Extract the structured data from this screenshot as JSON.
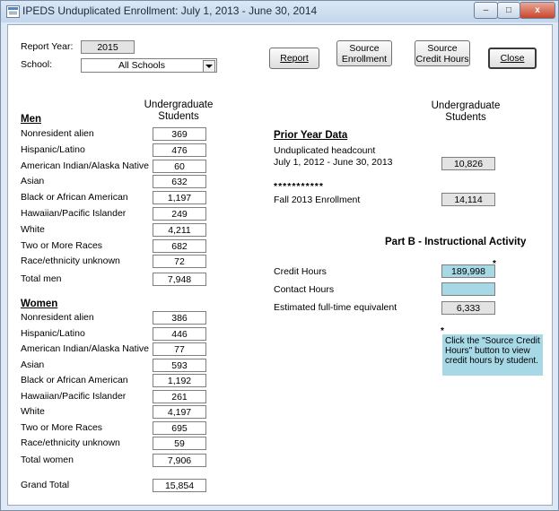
{
  "window": {
    "title": "IPEDS Unduplicated Enrollment:  July 1, 2013 - June 30, 2014",
    "minimize": "–",
    "maximize": "□",
    "close": "x"
  },
  "header": {
    "report_year_label": "Report Year:",
    "report_year_value": "2015",
    "school_label": "School:",
    "school_value": "All Schools"
  },
  "buttons": {
    "report": "Report",
    "source_enrollment": "Source\nEnrollment",
    "source_credit_hours": "Source\nCredit Hours",
    "close": "Close"
  },
  "left_column_header": "Undergraduate\nStudents",
  "men": {
    "title": "Men",
    "rows": [
      {
        "label": "Nonresident alien",
        "value": "369"
      },
      {
        "label": "Hispanic/Latino",
        "value": "476"
      },
      {
        "label": "American Indian/Alaska Native",
        "value": "60"
      },
      {
        "label": "Asian",
        "value": "632"
      },
      {
        "label": "Black or African American",
        "value": "1,197"
      },
      {
        "label": "Hawaiian/Pacific Islander",
        "value": "249"
      },
      {
        "label": "White",
        "value": "4,211"
      },
      {
        "label": "Two or More Races",
        "value": "682"
      },
      {
        "label": "Race/ethnicity unknown",
        "value": "72"
      }
    ],
    "total_label": "Total men",
    "total_value": "7,948"
  },
  "women": {
    "title": "Women",
    "rows": [
      {
        "label": "Nonresident alien",
        "value": "386"
      },
      {
        "label": "Hispanic/Latino",
        "value": "446"
      },
      {
        "label": "American Indian/Alaska Native",
        "value": "77"
      },
      {
        "label": "Asian",
        "value": "593"
      },
      {
        "label": "Black or African American",
        "value": "1,192"
      },
      {
        "label": "Hawaiian/Pacific Islander",
        "value": "261"
      },
      {
        "label": "White",
        "value": "4,197"
      },
      {
        "label": "Two or More Races",
        "value": "695"
      },
      {
        "label": "Race/ethnicity unknown",
        "value": "59"
      }
    ],
    "total_label": "Total women",
    "total_value": "7,906"
  },
  "grand_total_label": "Grand Total",
  "grand_total_value": "15,854",
  "right_column_header": "Undergraduate\nStudents",
  "prior_year": {
    "title": "Prior Year Data",
    "headcount_label": "Unduplicated headcount\nJuly 1, 2012 - June 30, 2013",
    "headcount_value": "10,826",
    "separator": "***********",
    "fall_label": "Fall 2013 Enrollment",
    "fall_value": "14,114"
  },
  "part_b": {
    "title": "Part B - Instructional Activity",
    "credit_hours_label": "Credit Hours",
    "credit_hours_value": "189,998",
    "contact_hours_label": "Contact Hours",
    "contact_hours_value": "",
    "fte_label": "Estimated full-time equivalent",
    "fte_value": "6,333",
    "asterisk": "*",
    "note": "Click the \"Source Credit Hours\" button to view credit hours by student."
  }
}
